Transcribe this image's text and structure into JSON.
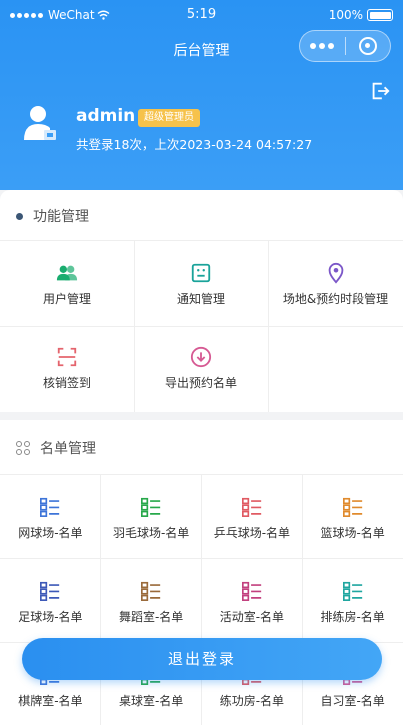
{
  "status_bar": {
    "carrier": "WeChat",
    "time": "5:19",
    "battery": "100%"
  },
  "navbar": {
    "title": "后台管理"
  },
  "user": {
    "name": "admin",
    "role": "超级管理员",
    "login_info": "共登录18次，上次2023-03-24 04:57:27"
  },
  "sections": {
    "functions": {
      "title": "功能管理",
      "items": [
        {
          "label": "用户管理",
          "icon": "users-icon",
          "color": "#1aad6f"
        },
        {
          "label": "通知管理",
          "icon": "notice-icon",
          "color": "#1aa39a"
        },
        {
          "label": "场地&预约时段管理",
          "icon": "location-icon",
          "color": "#7b57c8"
        },
        {
          "label": "核销签到",
          "icon": "scan-icon",
          "color": "#e4646d"
        },
        {
          "label": "导出预约名单",
          "icon": "export-icon",
          "color": "#d65a93"
        }
      ]
    },
    "lists": {
      "title": "名单管理",
      "items": [
        {
          "label": "网球场-名单",
          "color": "#3d74d8"
        },
        {
          "label": "羽毛球场-名单",
          "color": "#27a84a"
        },
        {
          "label": "乒乓球场-名单",
          "color": "#e05a62"
        },
        {
          "label": "篮球场-名单",
          "color": "#e08a2c"
        },
        {
          "label": "足球场-名单",
          "color": "#3d59b8"
        },
        {
          "label": "舞蹈室-名单",
          "color": "#9a6a3a"
        },
        {
          "label": "活动室-名单",
          "color": "#c2407e"
        },
        {
          "label": "排练房-名单",
          "color": "#1fa6a0"
        },
        {
          "label": "棋牌室-名单",
          "color": "#3d74d8"
        },
        {
          "label": "桌球室-名单",
          "color": "#27a84a"
        },
        {
          "label": "练功房-名单",
          "color": "#e05a62"
        },
        {
          "label": "自习室-名单",
          "color": "#d65a93"
        }
      ]
    }
  },
  "exit_button": {
    "label": "退出登录"
  }
}
